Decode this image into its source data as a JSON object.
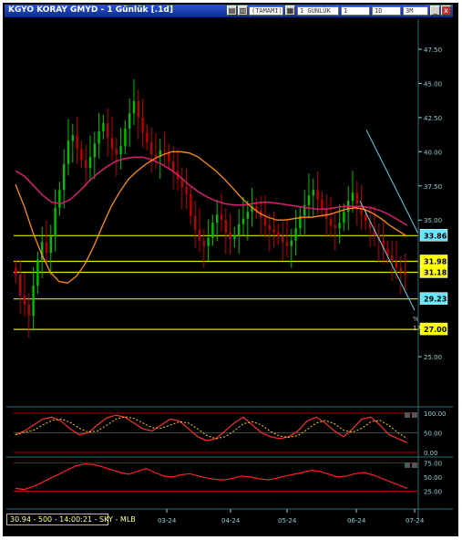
{
  "window": {
    "title": "KGYO KORAY GMYD - 1 Günlük [.1d]",
    "toolbar_fields": [
      "(TAMAMI)",
      "1 GÜNLÜK",
      "1",
      "1D",
      "3M"
    ]
  },
  "status_bar": "30.94 - 500 - 14:00:21 - SKY - MLB",
  "icons": [
    "chart-icon",
    "bars-icon",
    "candles-icon",
    "line-icon",
    "zoom-icon",
    "settings-icon",
    "minimize-icon",
    "maximize-icon",
    "close-icon"
  ],
  "colors": {
    "background": "#000000",
    "up": "#00c000",
    "down": "#c00000",
    "ma_fast": "#ff8c1a",
    "ma_slow": "#cc1f6b",
    "level_line": "#e6e600",
    "trend_line": "#5bd3e6",
    "price_badge_cyan": "#66e6ff",
    "price_badge_yellow": "#ffff00"
  },
  "price_axis": {
    "labels": [
      "47.50",
      "45.00",
      "42.50",
      "40.00",
      "37.50",
      "35.00",
      "25.00"
    ]
  },
  "price_badges": [
    {
      "value": "33.86",
      "style": "cyan"
    },
    {
      "value": "31.98",
      "style": "yellow"
    },
    {
      "value": "31.18",
      "style": "yellow"
    },
    {
      "value": "29.23",
      "style": "cyan"
    },
    {
      "value": "27.00",
      "style": "yellow"
    }
  ],
  "trendline_label": "%",
  "trendline_label2": "17",
  "time_axis": [
    "03-24",
    "04-24",
    "05-24",
    "06-24",
    "07-24"
  ],
  "panel2_axis": [
    "100.00",
    "50.00",
    "0.00"
  ],
  "panel3_axis": [
    "75.00",
    "50.00",
    "25.00"
  ],
  "chart_data": {
    "type": "candlestick",
    "ylim": [
      22.0,
      49.5
    ],
    "horizontal_levels": [
      33.86,
      31.98,
      31.18,
      29.23,
      27.0
    ],
    "candles_close": [
      31.0,
      29.5,
      28.8,
      28.0,
      30.2,
      32.1,
      33.4,
      32.6,
      33.8,
      35.9,
      37.2,
      39.1,
      40.8,
      41.2,
      40.2,
      39.4,
      38.8,
      39.6,
      40.6,
      41.5,
      42.1,
      41.0,
      40.2,
      39.8,
      40.4,
      41.7,
      42.8,
      43.7,
      42.5,
      41.4,
      40.7,
      39.8,
      39.6,
      40.1,
      40.0,
      39.3,
      38.6,
      38.0,
      37.4,
      36.9,
      35.3,
      34.3,
      33.5,
      33.1,
      33.7,
      34.8,
      35.4,
      35.0,
      34.1,
      33.6,
      33.9,
      34.7,
      35.1,
      35.6,
      36.0,
      35.7,
      35.2,
      34.6,
      34.3,
      34.1,
      33.8,
      33.4,
      33.1,
      33.5,
      34.4,
      35.3,
      36.1,
      36.8,
      37.2,
      36.5,
      35.8,
      35.1,
      34.6,
      34.4,
      34.8,
      35.6,
      36.4,
      37.0,
      36.2,
      35.4,
      34.9,
      34.4,
      33.9,
      33.5,
      32.9,
      32.4,
      31.9,
      31.5,
      31.2,
      31.0
    ],
    "ma_fast": [
      37.6,
      36.0,
      34.1,
      32.5,
      31.2,
      30.5,
      30.4,
      30.9,
      31.8,
      33.1,
      34.6,
      36.0,
      37.1,
      38.0,
      38.6,
      39.1,
      39.5,
      39.8,
      40.0,
      40.0,
      39.9,
      39.6,
      39.1,
      38.6,
      38.0,
      37.3,
      36.6,
      36.0,
      35.5,
      35.2,
      35.0,
      35.0,
      35.1,
      35.2,
      35.2,
      35.3,
      35.4,
      35.6,
      35.8,
      35.9,
      35.8,
      35.5,
      35.1,
      34.6,
      34.2,
      33.8
    ],
    "ma_slow": [
      38.6,
      38.2,
      37.5,
      36.8,
      36.3,
      36.2,
      36.5,
      37.1,
      37.8,
      38.4,
      38.9,
      39.3,
      39.5,
      39.6,
      39.6,
      39.4,
      39.1,
      38.7,
      38.2,
      37.6,
      37.1,
      36.7,
      36.4,
      36.2,
      36.1,
      36.1,
      36.2,
      36.3,
      36.3,
      36.2,
      36.1,
      36.0,
      35.9,
      35.8,
      35.8,
      35.9,
      36.0,
      36.0,
      36.0,
      35.9,
      35.7,
      35.4,
      35.0,
      34.6
    ],
    "stochastic": [
      45,
      55,
      70,
      85,
      90,
      80,
      60,
      45,
      50,
      70,
      88,
      95,
      90,
      75,
      60,
      55,
      70,
      85,
      80,
      60,
      40,
      30,
      35,
      55,
      75,
      90,
      70,
      50,
      40,
      35,
      40,
      55,
      80,
      90,
      75,
      55,
      40,
      60,
      85,
      90,
      70,
      45,
      35,
      25
    ],
    "rsi": [
      30,
      28,
      33,
      40,
      48,
      55,
      63,
      70,
      73,
      72,
      68,
      63,
      58,
      55,
      60,
      65,
      58,
      52,
      50,
      54,
      56,
      52,
      48,
      46,
      45,
      48,
      52,
      50,
      47,
      45,
      48,
      52,
      55,
      58,
      62,
      60,
      55,
      50,
      52,
      56,
      58,
      54,
      48,
      42,
      36,
      30
    ]
  }
}
